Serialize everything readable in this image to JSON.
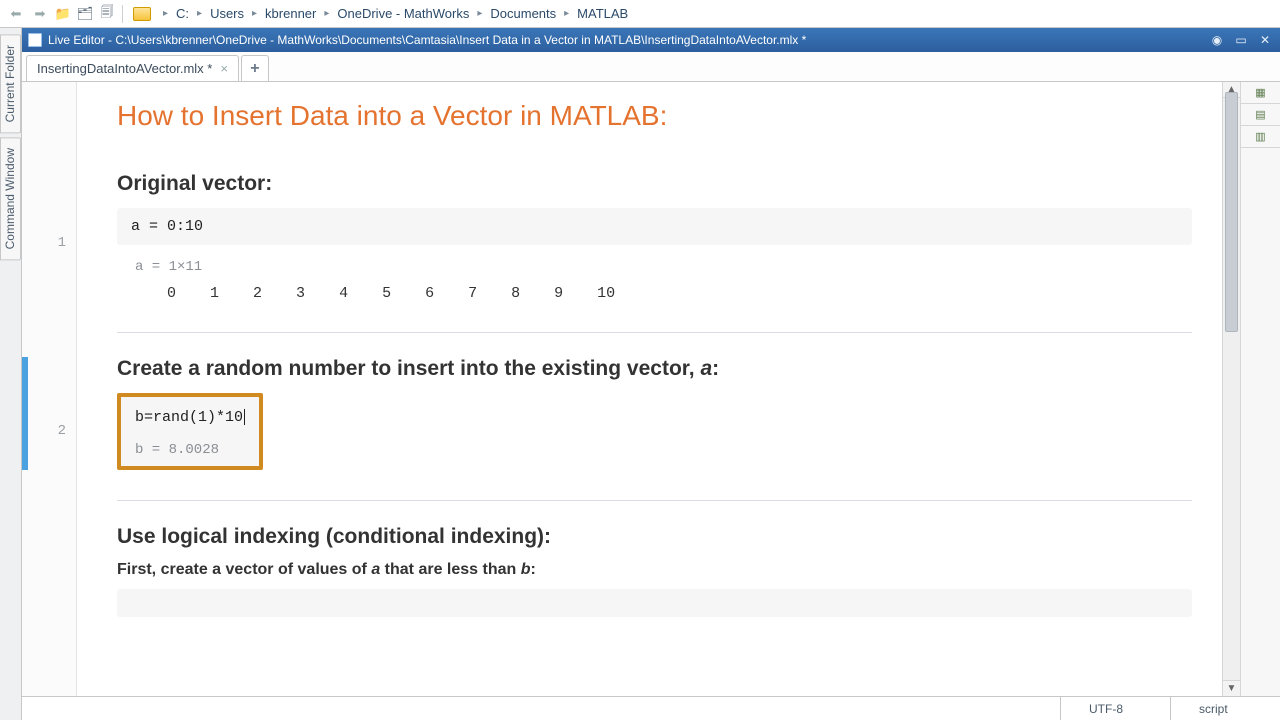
{
  "breadcrumb": {
    "root_glyph": "▸",
    "items": [
      "C:",
      "Users",
      "kbrenner",
      "OneDrive - MathWorks",
      "Documents",
      "MATLAB"
    ]
  },
  "side_panels": [
    "Current Folder",
    "Command Window"
  ],
  "editor": {
    "titlebar": "Live Editor - C:\\Users\\kbrenner\\OneDrive - MathWorks\\Documents\\Camtasia\\Insert Data in a Vector in MATLAB\\InsertingDataIntoAVector.mlx *",
    "tab_label": "InsertingDataIntoAVector.mlx *"
  },
  "document": {
    "title": "How to Insert Data into a Vector in MATLAB:",
    "section1": {
      "heading": "Original vector:",
      "code": "a = 0:10",
      "out_label": "a = 1×11",
      "out_values": [
        "0",
        "1",
        "2",
        "3",
        "4",
        "5",
        "6",
        "7",
        "8",
        "9",
        "10"
      ]
    },
    "section2": {
      "heading_pre": "Create a random number to insert into the existing vector, ",
      "heading_var": "a",
      "heading_post": ":",
      "code": "b=rand(1)*10",
      "out": "b = 8.0028"
    },
    "section3": {
      "heading": "Use logical indexing (conditional indexing):",
      "sub_pre": "First, create a vector of values of ",
      "sub_a": "a",
      "sub_mid": " that are less than ",
      "sub_b": "b",
      "sub_post": ":"
    },
    "line_numbers": {
      "l1": "1",
      "l2": "2"
    }
  },
  "status": {
    "encoding": "UTF-8",
    "mode": "script"
  },
  "rail_buttons": [
    "▦",
    "▤",
    "▥"
  ]
}
